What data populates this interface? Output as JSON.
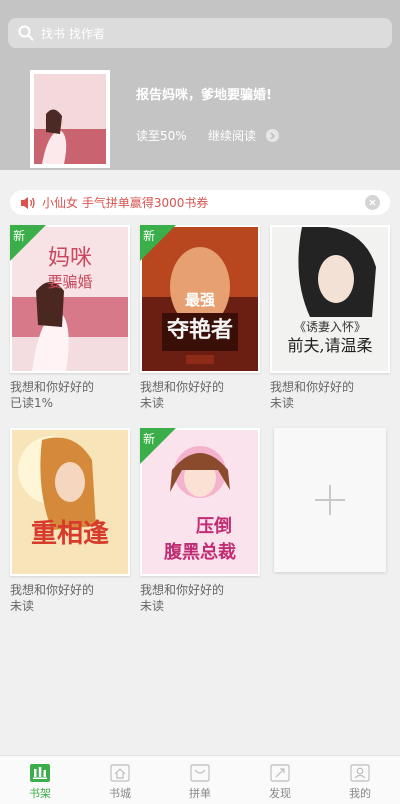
{
  "search": {
    "placeholder": "找书 找作者"
  },
  "current_book": {
    "title": "报告妈咪，爹地要骗婚!",
    "progress_text": "读至50%",
    "continue_label": "继续阅读"
  },
  "notice": {
    "text": "小仙女 手气拼单赢得3000书券"
  },
  "new_badge_label": "新",
  "books": [
    {
      "name": "我想和你好好的",
      "status": "已读1%",
      "is_new": true
    },
    {
      "name": "我想和你好好的",
      "status": "未读",
      "is_new": true
    },
    {
      "name": "我想和你好好的",
      "status": "未读",
      "is_new": false
    },
    {
      "name": "我想和你好好的",
      "status": "未读",
      "is_new": false
    },
    {
      "name": "我想和你好好的",
      "status": "未读",
      "is_new": true
    }
  ],
  "covers": [
    {
      "lines": [
        "妈咪",
        "要骗婚"
      ]
    },
    {
      "lines": [
        "最强",
        "夺艳者"
      ]
    },
    {
      "lines": [
        "《诱妻入怀》",
        "前夫,请温柔"
      ]
    },
    {
      "lines": [
        "重相逢"
      ]
    },
    {
      "lines": [
        "压倒",
        "腹黑总裁"
      ]
    }
  ],
  "tabs": [
    {
      "label": "书架",
      "active": true
    },
    {
      "label": "书城",
      "active": false
    },
    {
      "label": "拼单",
      "active": false
    },
    {
      "label": "发现",
      "active": false
    },
    {
      "label": "我的",
      "active": false
    }
  ],
  "colors": {
    "accent": "#3aae48",
    "notice_text": "#d9534f",
    "header_bg": "#c4c4c4"
  }
}
